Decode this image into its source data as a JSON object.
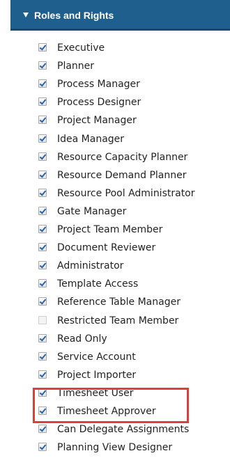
{
  "header": {
    "title": "Roles and Rights"
  },
  "roles": [
    {
      "label": "Executive",
      "checked": true
    },
    {
      "label": "Planner",
      "checked": true
    },
    {
      "label": "Process Manager",
      "checked": true
    },
    {
      "label": "Process Designer",
      "checked": true
    },
    {
      "label": "Project Manager",
      "checked": true
    },
    {
      "label": "Idea Manager",
      "checked": true
    },
    {
      "label": "Resource Capacity Planner",
      "checked": true
    },
    {
      "label": "Resource Demand Planner",
      "checked": true
    },
    {
      "label": "Resource Pool Administrator",
      "checked": true
    },
    {
      "label": "Gate Manager",
      "checked": true
    },
    {
      "label": "Project Team Member",
      "checked": true
    },
    {
      "label": "Document Reviewer",
      "checked": true
    },
    {
      "label": "Administrator",
      "checked": true
    },
    {
      "label": "Template Access",
      "checked": true
    },
    {
      "label": "Reference Table Manager",
      "checked": true
    },
    {
      "label": "Restricted Team Member",
      "checked": false
    },
    {
      "label": "Read Only",
      "checked": true
    },
    {
      "label": "Service Account",
      "checked": true
    },
    {
      "label": "Project Importer",
      "checked": true
    },
    {
      "label": "Timesheet User",
      "checked": true
    },
    {
      "label": "Timesheet Approver",
      "checked": true
    },
    {
      "label": "Can Delegate Assignments",
      "checked": true
    },
    {
      "label": "Planning View Designer",
      "checked": true
    }
  ],
  "colors": {
    "header_bg": "#1f5f8d",
    "highlight": "#d9403c",
    "check": "#2a63a8"
  }
}
